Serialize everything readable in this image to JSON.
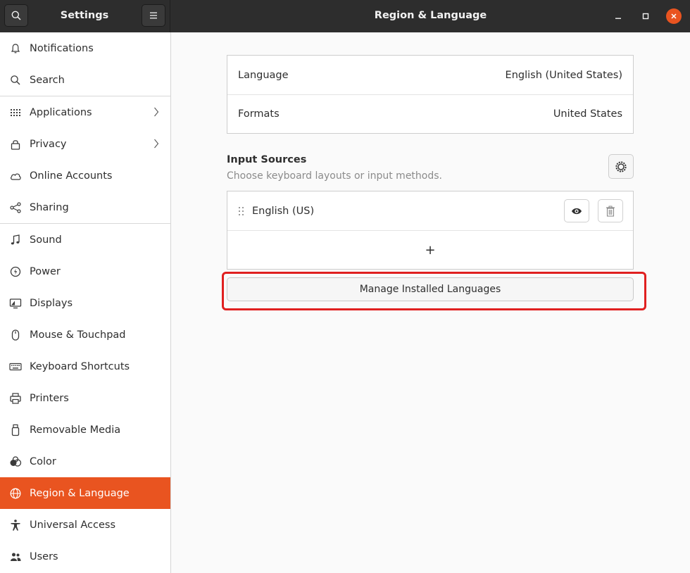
{
  "header": {
    "app_title": "Settings",
    "page_title": "Region & Language"
  },
  "sidebar": {
    "items": [
      {
        "label": "Notifications",
        "icon": "bell-icon"
      },
      {
        "label": "Search",
        "icon": "search-icon"
      },
      {
        "label": "Applications",
        "icon": "apps-grid-icon",
        "has_arrow": true
      },
      {
        "label": "Privacy",
        "icon": "lock-icon",
        "has_arrow": true
      },
      {
        "label": "Online Accounts",
        "icon": "cloud-icon"
      },
      {
        "label": "Sharing",
        "icon": "share-icon"
      },
      {
        "label": "Sound",
        "icon": "music-note-icon"
      },
      {
        "label": "Power",
        "icon": "power-icon"
      },
      {
        "label": "Displays",
        "icon": "display-icon"
      },
      {
        "label": "Mouse & Touchpad",
        "icon": "mouse-icon"
      },
      {
        "label": "Keyboard Shortcuts",
        "icon": "keyboard-icon"
      },
      {
        "label": "Printers",
        "icon": "printer-icon"
      },
      {
        "label": "Removable Media",
        "icon": "usb-drive-icon"
      },
      {
        "label": "Color",
        "icon": "color-icon"
      },
      {
        "label": "Region & Language",
        "icon": "globe-icon",
        "active": true
      },
      {
        "label": "Universal Access",
        "icon": "accessibility-icon"
      },
      {
        "label": "Users",
        "icon": "users-icon"
      }
    ]
  },
  "region": {
    "language_label": "Language",
    "language_value": "English (United States)",
    "formats_label": "Formats",
    "formats_value": "United States"
  },
  "input_sources": {
    "title": "Input Sources",
    "subtitle": "Choose keyboard layouts or input methods.",
    "items": [
      {
        "label": "English (US)"
      }
    ],
    "add_label": "+"
  },
  "manage_button_label": "Manage Installed Languages",
  "colors": {
    "accent": "#e95420",
    "highlight": "#e02020",
    "headerbar": "#2d2d2d"
  }
}
